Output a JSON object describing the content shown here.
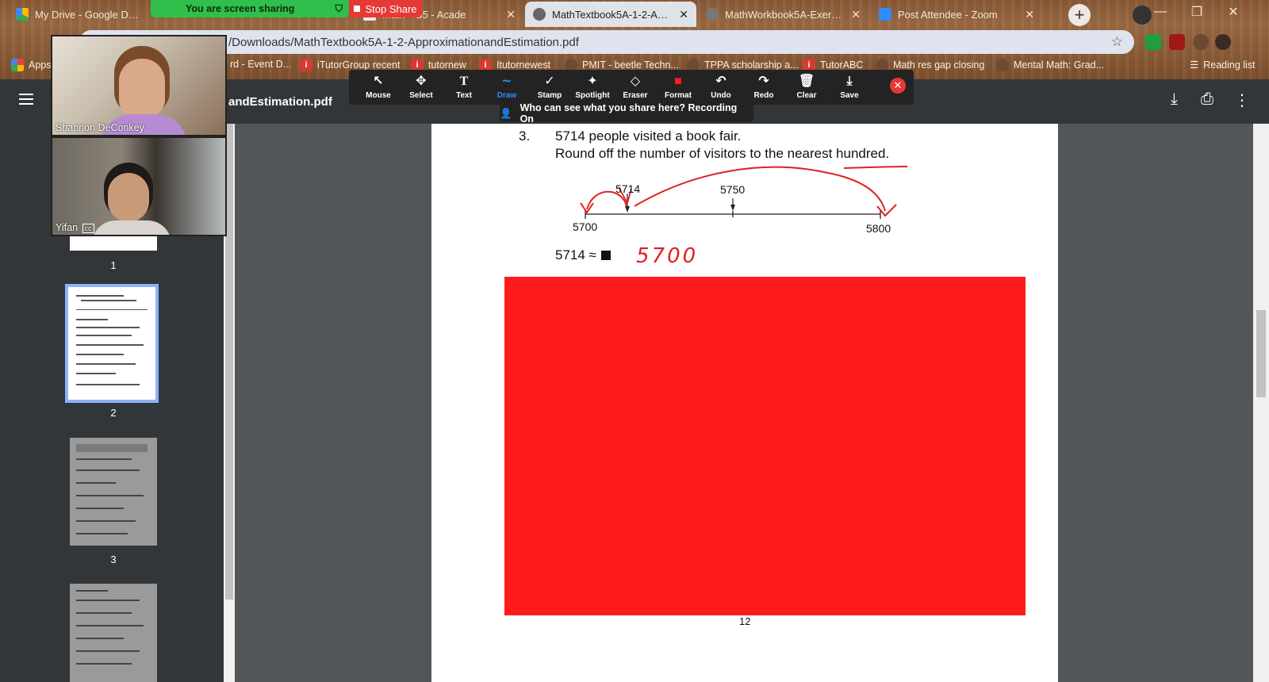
{
  "browser": {
    "tabs": [
      {
        "label": "My Drive - Google Drive",
        "active": false
      },
      {
        "label": "Math - G5 - Acade",
        "active": false
      },
      {
        "label": "MathTextbook5A-1-2-Approx",
        "active": true
      },
      {
        "label": "MathWorkbook5A-Exercise4_",
        "active": false
      },
      {
        "label": "Post Attendee - Zoom",
        "active": false
      }
    ],
    "close_glyph": "✕",
    "new_tab": "+",
    "url": "/Downloads/MathTextbook5A-1-2-ApproximationandEstimation.pdf",
    "bookmarks": [
      {
        "label": "Apps"
      },
      {
        "label": "rd - Event D..."
      },
      {
        "label": "iTutorGroup recent"
      },
      {
        "label": "tutornew"
      },
      {
        "label": "Itutornewest"
      },
      {
        "label": "PMIT - beetle Techn..."
      },
      {
        "label": "TPPA scholarship a..."
      },
      {
        "label": "TutorABC"
      },
      {
        "label": "Math res gap closing"
      },
      {
        "label": "Mental Math: Grad..."
      },
      {
        "label": "Reading list"
      }
    ]
  },
  "zoom": {
    "share_banner": "You are screen sharing",
    "stop_share": "Stop Share",
    "who_can_see": "Who can see what you share here? Recording On",
    "tools": [
      {
        "label": "Mouse",
        "icon": "↖"
      },
      {
        "label": "Select",
        "icon": "✥"
      },
      {
        "label": "Text",
        "icon": "T"
      },
      {
        "label": "Draw",
        "icon": "∼",
        "active": true
      },
      {
        "label": "Stamp",
        "icon": "✓"
      },
      {
        "label": "Spotlight",
        "icon": "✦"
      },
      {
        "label": "Eraser",
        "icon": "◇"
      },
      {
        "label": "Format",
        "icon": "■"
      },
      {
        "label": "Undo",
        "icon": "↶"
      },
      {
        "label": "Redo",
        "icon": "↷"
      },
      {
        "label": "Clear",
        "icon": "🗑"
      },
      {
        "label": "Save",
        "icon": "⤓"
      }
    ],
    "participants": [
      {
        "name": "Shannon DeConkey"
      },
      {
        "name": "Yifan"
      }
    ]
  },
  "pdf": {
    "title": "andEstimation.pdf",
    "thumbnails": [
      {
        "page": "1"
      },
      {
        "page": "2"
      },
      {
        "page": "3"
      }
    ],
    "question": {
      "number": "3.",
      "line1": "5714 people visited a book fair.",
      "line2": "Round off the number of visitors to the nearest hundred.",
      "number_line": {
        "labels": [
          "5714",
          "5750",
          "5700",
          "5800"
        ]
      },
      "equation": "5714 ≈",
      "handwritten_answer": "5700"
    },
    "page_number": "12"
  },
  "colors": {
    "annotation_red": "#ff1b1b",
    "zoom_green": "#2fbf4a",
    "zoom_blue": "#2d8cff"
  }
}
